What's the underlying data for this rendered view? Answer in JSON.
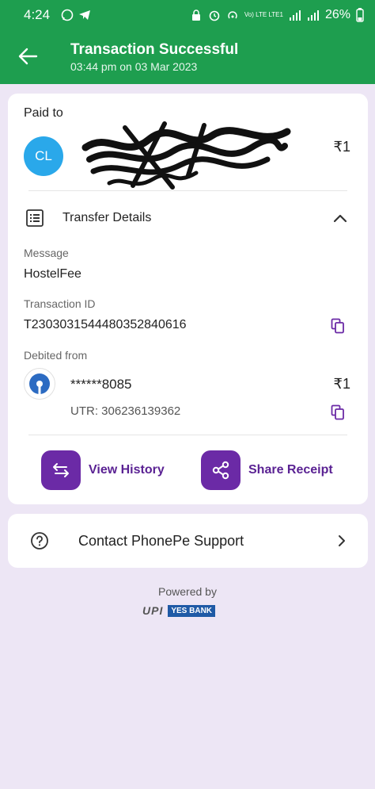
{
  "status": {
    "time": "4:24",
    "network": "Vo) LTE LTE1",
    "battery": "26%"
  },
  "header": {
    "title": "Transaction Successful",
    "subtitle": "03:44 pm on 03 Mar 2023"
  },
  "payee": {
    "label": "Paid to",
    "initials": "CL",
    "amount": "₹1"
  },
  "transfer": {
    "label": "Transfer Details",
    "message_label": "Message",
    "message": "HostelFee",
    "txn_label": "Transaction ID",
    "txn_id": "T2303031544480352840616",
    "debited_label": "Debited from",
    "account": "******8085",
    "amount": "₹1",
    "utr": "UTR: 306236139362"
  },
  "actions": {
    "history": "View History",
    "share": "Share Receipt"
  },
  "support": {
    "label": "Contact PhonePe Support"
  },
  "footer": {
    "powered": "Powered by",
    "upi": "UPI",
    "bank": "YES BANK"
  },
  "colors": {
    "brand_green": "#1e9e4f",
    "accent_purple": "#6b2aa6",
    "background": "#ede6f5"
  }
}
